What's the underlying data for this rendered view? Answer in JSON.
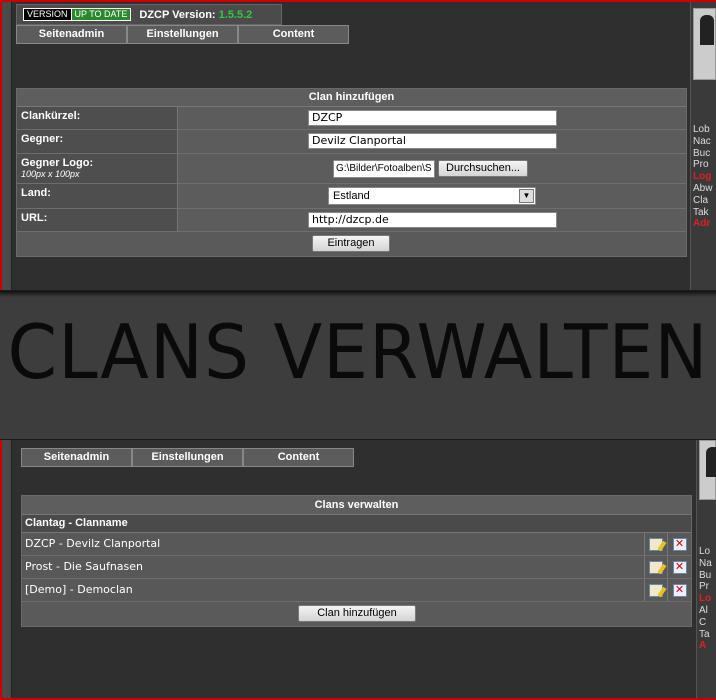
{
  "version": {
    "badge_left": "VERSION",
    "badge_right": "UP TO DATE",
    "label": "DZCP Version:",
    "number": "1.5.5.2"
  },
  "tabs": [
    "Seitenadmin",
    "Einstellungen",
    "Content"
  ],
  "add_form": {
    "title": "Clan hinzufügen",
    "fields": {
      "clankuerzel": {
        "label": "Clankürzel:",
        "value": "DZCP"
      },
      "gegner": {
        "label": "Gegner:",
        "value": "Devilz Clanportal"
      },
      "logo": {
        "label": "Gegner Logo:",
        "sub": "100px x 100px",
        "value": "G:\\Bilder\\Fotoalben\\S",
        "browse": "Durchsuchen..."
      },
      "land": {
        "label": "Land:",
        "value": "Estland"
      },
      "url": {
        "label": "URL:",
        "value": "http://dzcp.de"
      }
    },
    "submit": "Eintragen"
  },
  "banner": {
    "title": "CLANS VERWALTEN"
  },
  "manage": {
    "title": "Clans verwalten",
    "column_header": "Clantag - Clanname",
    "rows": [
      {
        "name": "DZCP - Devilz Clanportal"
      },
      {
        "name": "Prost - Die Saufnasen"
      },
      {
        "name": "[Demo] - Democlan"
      }
    ],
    "add_button": "Clan hinzufügen"
  },
  "right_menu_top": [
    "Lob",
    "Nac",
    "Buc",
    "Pro",
    "Log",
    "Abw",
    "Cla",
    "Tak",
    "Adr"
  ],
  "right_menu_bottom": [
    "Lo",
    "Na",
    "Bu",
    "Pr",
    "Lo",
    "Al",
    "C",
    "Ta",
    "A"
  ],
  "colors": {
    "accent_red": "#e02020",
    "version_green": "#2ecc40",
    "border_red": "#cc0000"
  }
}
